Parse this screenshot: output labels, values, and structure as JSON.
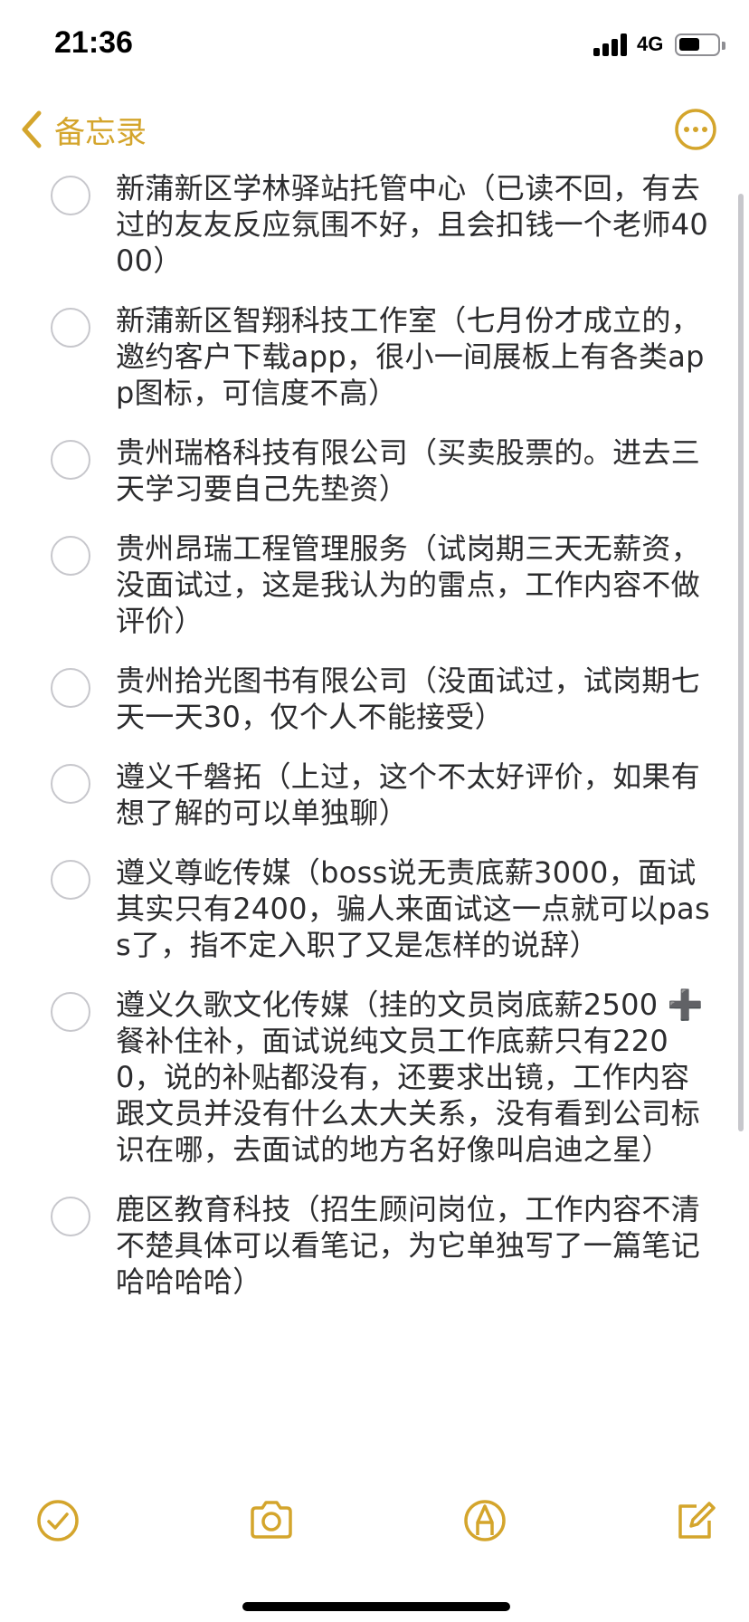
{
  "status_bar": {
    "time": "21:36",
    "network": "4G",
    "battery_level": 0.55
  },
  "nav": {
    "back_label": "备忘录",
    "more_icon": "ellipsis-circle-icon",
    "accent_color": "#d4a52c"
  },
  "checklist": {
    "items": [
      {
        "text": "新蒲新区学林驿站托管中心（已读不回，有去过的友友反应氛围不好，且会扣钱一个老师4000）",
        "checked": false
      },
      {
        "text": "新蒲新区智翔科技工作室（七月份才成立的，邀约客户下载app，很小一间展板上有各类app图标，可信度不高）",
        "checked": false
      },
      {
        "text": "贵州瑞格科技有限公司（买卖股票的。进去三天学习要自己先垫资）",
        "checked": false
      },
      {
        "text": "贵州昂瑞工程管理服务（试岗期三天无薪资，没面试过，这是我认为的雷点，工作内容不做评价）",
        "checked": false
      },
      {
        "text": "贵州拾光图书有限公司（没面试过，试岗期七天一天30，仅个人不能接受）",
        "checked": false
      },
      {
        "text": "遵义千磐拓（上过，这个不太好评价，如果有想了解的可以单独聊）",
        "checked": false
      },
      {
        "text": "遵义尊屹传媒（boss说无责底薪3000，面试其实只有2400，骗人来面试这一点就可以pass了，指不定入职了又是怎样的说辞）",
        "checked": false
      },
      {
        "text": "遵义久歌文化传媒（挂的文员岗底薪2500 ➕ 餐补住补，面试说纯文员工作底薪只有2200，说的补贴都没有，还要求出镜，工作内容跟文员并没有什么太大关系，没有看到公司标识在哪，去面试的地方名好像叫启迪之星）",
        "checked": false
      },
      {
        "text": "鹿区教育科技（招生顾问岗位，工作内容不清不楚具体可以看笔记，为它单独写了一篇笔记哈哈哈哈）",
        "checked": false
      }
    ]
  },
  "toolbar": {
    "icons": [
      "checklist-icon",
      "camera-icon",
      "markup-pen-icon",
      "compose-icon"
    ]
  }
}
